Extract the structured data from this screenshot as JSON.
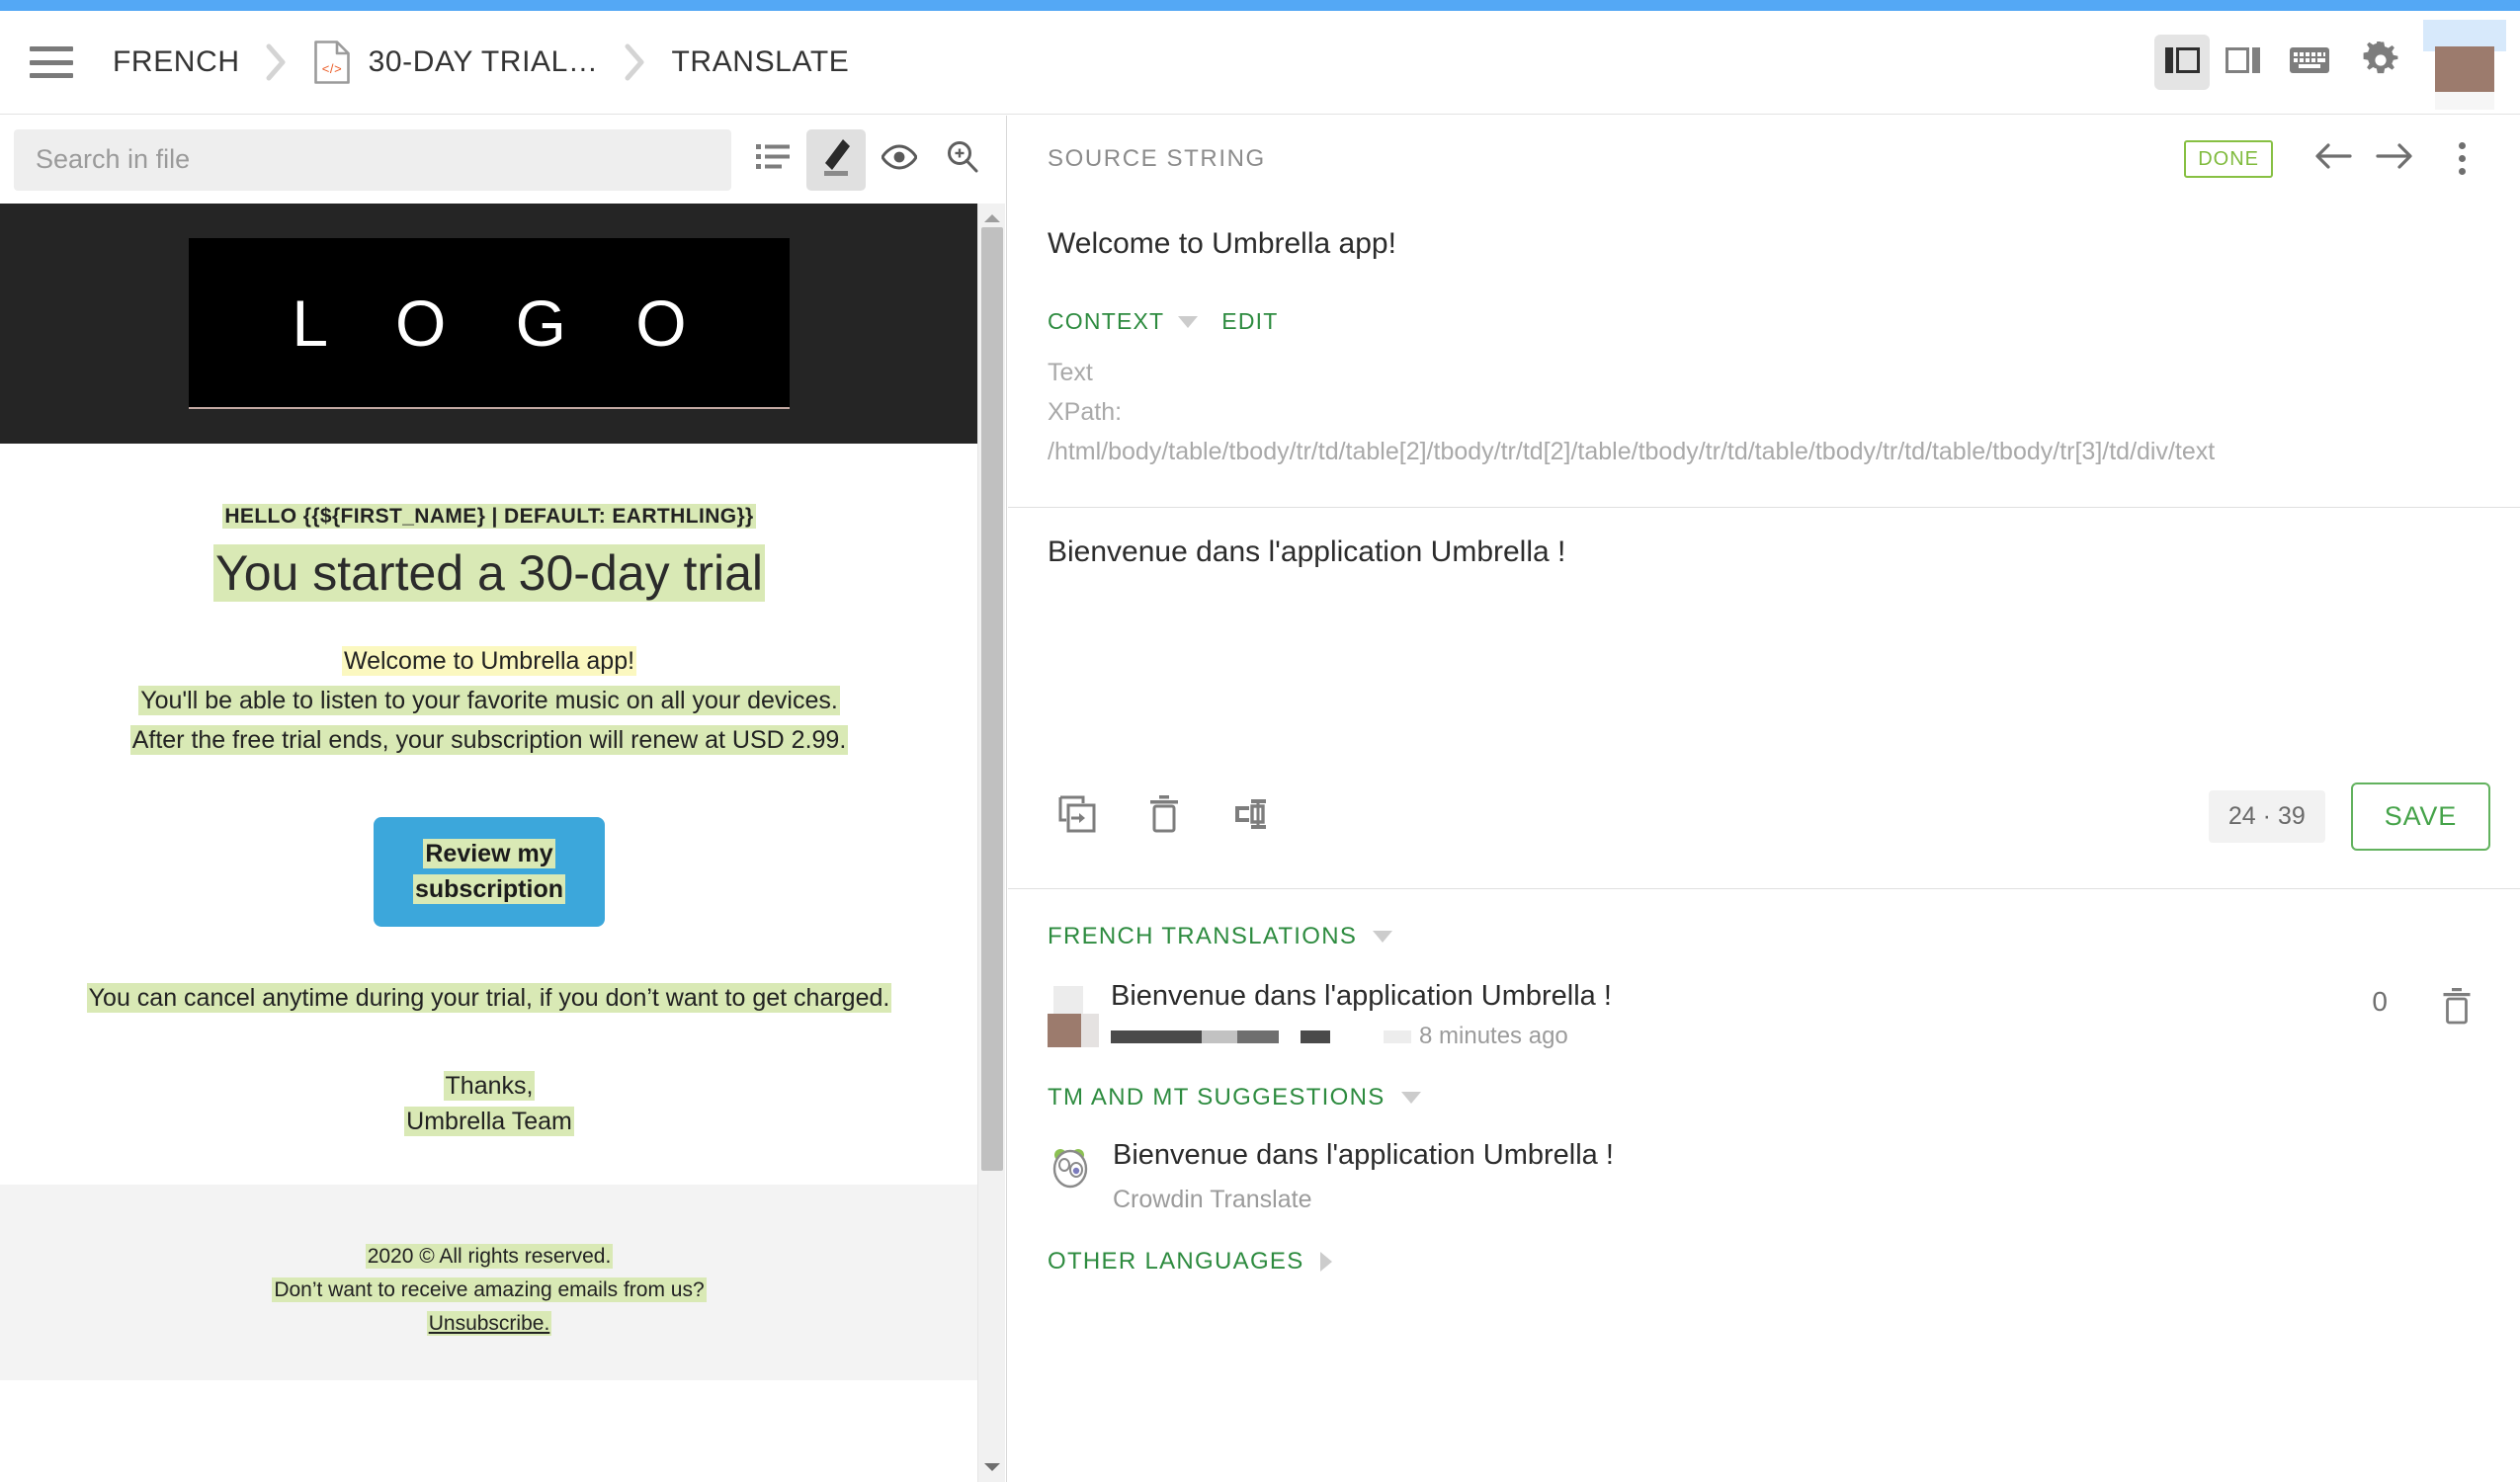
{
  "colors": {
    "accent_bar": "#54a8f5",
    "brand_green": "#2d8b3f",
    "save_green": "#45a349",
    "done_green": "#80bb3e",
    "highlight_green": "#d9e9b5",
    "highlight_active_yellow": "#fbf8c0",
    "cta_blue": "#3ca7db",
    "avatar_brown": "#9c7b6d"
  },
  "header": {
    "menu_icon": "hamburger-menu-icon",
    "breadcrumbs": [
      {
        "label": "FRENCH",
        "icon": null
      },
      {
        "label": "30-DAY TRIAL…",
        "icon": "html-file-icon"
      },
      {
        "label": "TRANSLATE",
        "icon": null
      }
    ],
    "tools": [
      {
        "name": "split-view-layout",
        "icon": "panel-left-layout-icon",
        "active": true
      },
      {
        "name": "side-panel-layout",
        "icon": "panel-right-layout-icon",
        "active": false
      },
      {
        "name": "keyboard-shortcuts",
        "icon": "keyboard-icon",
        "active": false
      },
      {
        "name": "settings",
        "icon": "gear-icon",
        "active": false
      }
    ],
    "avatar": "user-avatar"
  },
  "left_panel": {
    "search": {
      "placeholder": "Search in file",
      "value": ""
    },
    "view_buttons": [
      {
        "name": "list-view",
        "icon": "list-icon",
        "active": false
      },
      {
        "name": "edit-mode",
        "icon": "pencil-icon",
        "active": true
      },
      {
        "name": "preview-mode",
        "icon": "eye-icon",
        "active": false
      },
      {
        "name": "zoom-search",
        "icon": "magnifier-plus-icon",
        "active": false
      }
    ],
    "preview": {
      "logo_text": "L O G O",
      "eyebrow": "HELLO {{${FIRST_NAME} | DEFAULT: EARTHLING}}",
      "headline": "You started a 30-day trial",
      "paragraph": [
        "Welcome to Umbrella app!",
        "You'll be able to listen to your favorite music on all your devices.",
        "After the free trial ends, your subscription will renew at USD 2.99."
      ],
      "cta_line1": "Review my",
      "cta_line2": "subscription",
      "cancel_note": "You can cancel anytime during your trial, if you don’t want to get charged.",
      "thanks_line1": "Thanks,",
      "thanks_line2": "Umbrella Team",
      "footer": [
        "2020 © All rights reserved.",
        "Don’t want to receive amazing emails from us?",
        "Unsubscribe."
      ]
    }
  },
  "right_panel": {
    "source": {
      "title": "SOURCE STRING",
      "status_badge": "DONE",
      "prev_icon": "arrow-left-icon",
      "next_icon": "arrow-right-icon",
      "more_icon": "kebab-menu-icon",
      "text": "Welcome to Umbrella app!"
    },
    "context": {
      "label": "CONTEXT",
      "edit_label": "EDIT",
      "line1": "Text",
      "line2": "XPath:",
      "line3": "/html/body/table/tbody/tr/td/table[2]/tbody/tr/td[2]/table/tbody/tr/td/table/tbody/tr/td/table/tbody/tr[3]/td/div/text"
    },
    "translation": {
      "value": "Bienvenue dans l'application Umbrella !",
      "actions": [
        {
          "name": "copy-source",
          "icon": "copy-source-icon"
        },
        {
          "name": "clear-translation",
          "icon": "trash-icon"
        },
        {
          "name": "hidden-characters",
          "icon": "hidden-characters-icon"
        }
      ],
      "char_count": "24",
      "count_separator": "·",
      "char_limit": "39",
      "save_label": "SAVE"
    },
    "french_translations": {
      "title": "FRENCH TRANSLATIONS",
      "items": [
        {
          "text": "Bienvenue dans l'application Umbrella !",
          "author": "",
          "time": "8 minutes ago",
          "votes": "0",
          "delete_icon": "trash-icon"
        }
      ]
    },
    "tm_mt_suggestions": {
      "title": "TM AND MT SUGGESTIONS",
      "items": [
        {
          "text": "Bienvenue dans l'application Umbrella !",
          "source": "Crowdin Translate",
          "icon": "crowdin-mascot-icon"
        }
      ]
    },
    "other_languages": {
      "title": "OTHER LANGUAGES"
    }
  }
}
